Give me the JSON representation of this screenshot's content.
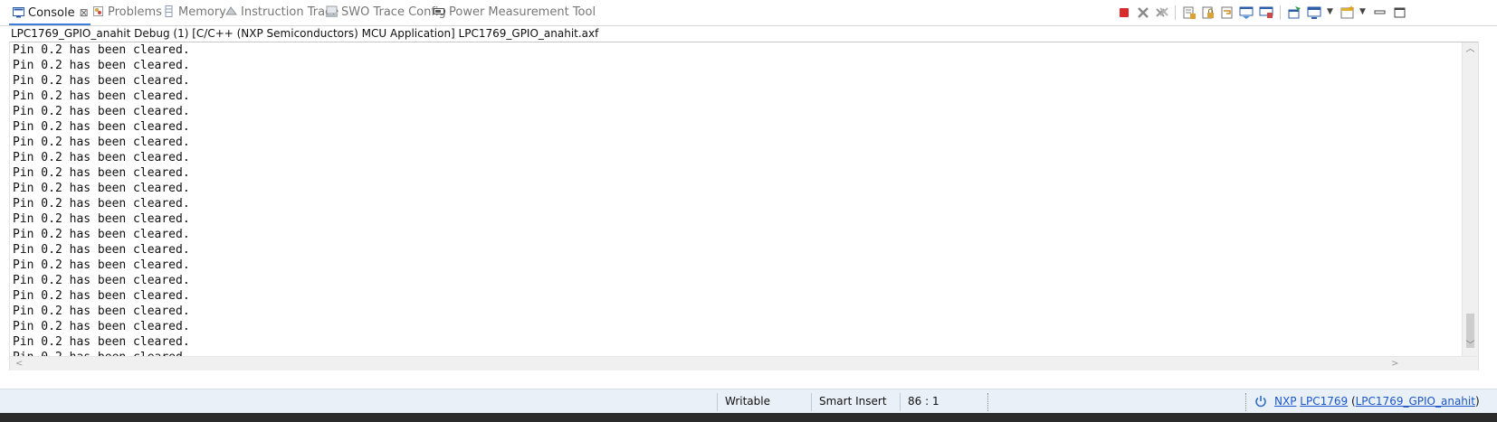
{
  "tabs": [
    {
      "label": "Console",
      "icon": "console-icon",
      "active": true
    },
    {
      "label": "Problems",
      "icon": "problems-icon",
      "active": false
    },
    {
      "label": "Memory",
      "icon": "memory-icon",
      "active": false
    },
    {
      "label": "Instruction Trace",
      "icon": "instruction-trace-icon",
      "active": false
    },
    {
      "label": "SWO Trace Config",
      "icon": "swo-icon",
      "active": false
    },
    {
      "label": "Power Measurement Tool",
      "icon": "battery-icon",
      "active": false
    }
  ],
  "toolbar": {
    "icons": [
      "terminate-icon",
      "remove-launch-icon",
      "remove-all-icon",
      "clear-console-icon",
      "scroll-lock-icon",
      "word-wrap-icon",
      "show-on-output-icon",
      "show-on-error-icon",
      "pin-console-icon",
      "display-console-icon",
      "new-console-icon",
      "minimize-icon",
      "maximize-icon"
    ]
  },
  "console": {
    "process_label": "LPC1769_GPIO_anahit Debug (1) [C/C++ (NXP Semiconductors) MCU Application] LPC1769_GPIO_anahit.axf",
    "lines": [
      "Pin 0.2 has been cleared.",
      "Pin 0.2 has been cleared.",
      "Pin 0.2 has been cleared.",
      "Pin 0.2 has been cleared.",
      "Pin 0.2 has been cleared.",
      "Pin 0.2 has been cleared.",
      "Pin 0.2 has been cleared.",
      "Pin 0.2 has been cleared.",
      "Pin 0.2 has been cleared.",
      "Pin 0.2 has been cleared.",
      "Pin 0.2 has been cleared.",
      "Pin 0.2 has been cleared.",
      "Pin 0.2 has been cleared.",
      "Pin 0.2 has been cleared.",
      "Pin 0.2 has been cleared.",
      "Pin 0.2 has been cleared.",
      "Pin 0.2 has been cleared.",
      "Pin 0.2 has been cleared.",
      "Pin 0.2 has been cleared.",
      "Pin 0.2 has been cleared.",
      "Pin 0.2 has been cleared.",
      "Pin 0.2 has been cleared."
    ]
  },
  "status": {
    "writable": "Writable",
    "insert_mode": "Smart Insert",
    "cursor_pos": "86 : 1",
    "vendor": "NXP",
    "device": "LPC1769",
    "project": "LPC1769_GPIO_anahit",
    "paren_open": "(",
    "paren_close": ")"
  },
  "colors": {
    "accent": "#3b7dd8",
    "terminate_red": "#d92b2b",
    "status_bg": "#eaf0f7",
    "link": "#1a56c8"
  }
}
